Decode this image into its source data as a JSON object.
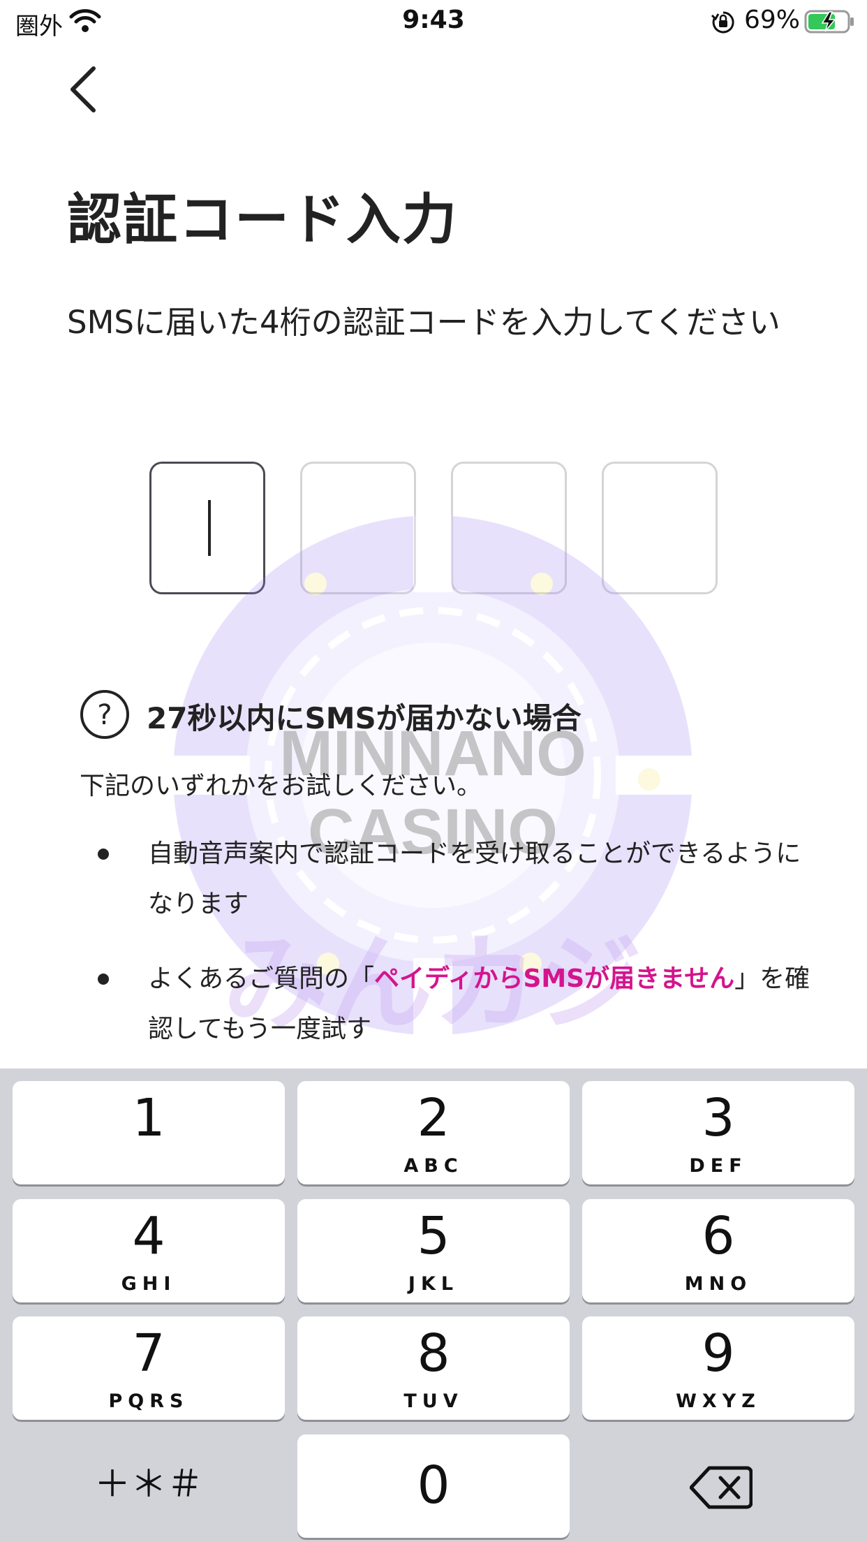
{
  "status_bar": {
    "carrier": "圏外",
    "time": "9:43",
    "battery_percent": "69%"
  },
  "header": {
    "title": "認証コード入力",
    "instruction": "SMSに届いた4桁の認証コードを入力してください"
  },
  "code_input": {
    "digits": [
      "",
      "",
      "",
      ""
    ],
    "active_index": 0
  },
  "watermark": {
    "line1": "MINNANO",
    "line2": "CASINO",
    "line3": "みんカジ"
  },
  "help": {
    "heading": "27秒以内にSMSが届かない場合",
    "subtext": "下記のいずれかをお試しください。",
    "bullets": {
      "b1": "自動音声案内で認証コードを受け取ることができるようになります",
      "b2_prefix": "よくあるご質問の「",
      "b2_link": "ペイディからSMSが届きません",
      "b2_suffix": "」を確認してもう一度試す"
    }
  },
  "keypad": {
    "keys": [
      {
        "num": "1",
        "letters": ""
      },
      {
        "num": "2",
        "letters": "ABC"
      },
      {
        "num": "3",
        "letters": "DEF"
      },
      {
        "num": "4",
        "letters": "GHI"
      },
      {
        "num": "5",
        "letters": "JKL"
      },
      {
        "num": "6",
        "letters": "MNO"
      },
      {
        "num": "7",
        "letters": "PQRS"
      },
      {
        "num": "8",
        "letters": "TUV"
      },
      {
        "num": "9",
        "letters": "WXYZ"
      },
      {
        "num": "0",
        "letters": ""
      }
    ],
    "symbols_label": "＋＊＃"
  },
  "colors": {
    "link": "#d4148c",
    "keypad_bg": "#d1d3d9",
    "watermark": "#7c4dff"
  },
  "icons": {
    "back": "chevron-left-icon",
    "help": "question-circle-icon",
    "backspace": "backspace-icon"
  }
}
